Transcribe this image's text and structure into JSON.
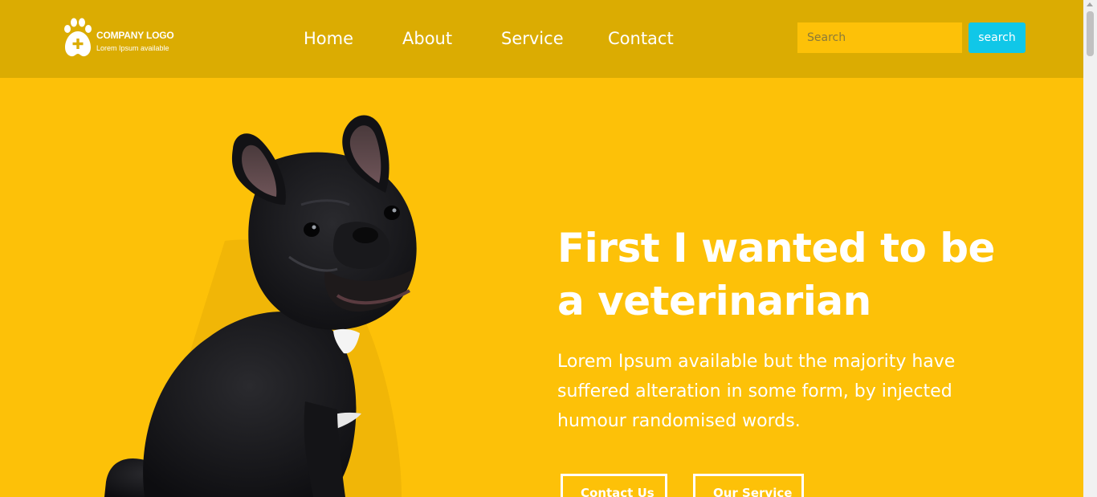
{
  "brand": {
    "logo_title": "COMPANY LOGO",
    "logo_subtitle": "Lorem Ipsum available"
  },
  "nav": {
    "items": [
      {
        "label": "Home"
      },
      {
        "label": "About"
      },
      {
        "label": "Service"
      },
      {
        "label": "Contact"
      }
    ]
  },
  "search": {
    "placeholder": "Search",
    "button_label": "search"
  },
  "hero": {
    "title": "First I wanted to be a veterinarian",
    "text": "Lorem Ipsum available but the majority have suffered alteration in some form, by injected humour randomised words.",
    "buttons": [
      {
        "label": "Contact Us"
      },
      {
        "label": "Our Service"
      }
    ]
  },
  "colors": {
    "header_bg": "#dbac02",
    "page_bg": "#fdc108",
    "search_button_bg": "#10c7e8",
    "text": "#ffffff"
  },
  "icons": {
    "logo": "paw-plus-icon",
    "hero_image": "french-bulldog-photo"
  }
}
